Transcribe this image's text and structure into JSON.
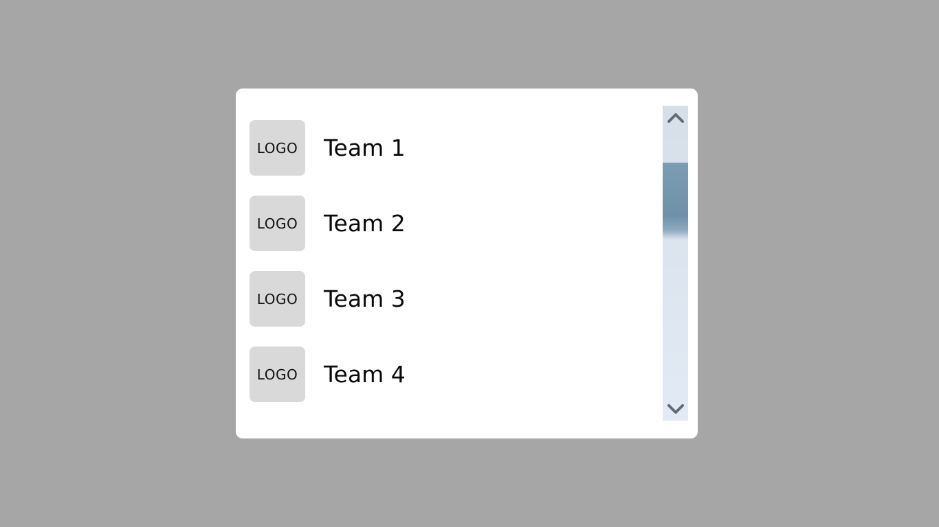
{
  "teams": [
    {
      "logo": "LOGO",
      "name": "Team 1"
    },
    {
      "logo": "LOGO",
      "name": "Team 2"
    },
    {
      "logo": "LOGO",
      "name": "Team 3"
    },
    {
      "logo": "LOGO",
      "name": "Team 4"
    }
  ],
  "scrollbar": {
    "up_icon": "chevron-up-icon",
    "down_icon": "chevron-down-icon",
    "thumb_color": "#7396ad",
    "track_color": "#dde6f0"
  },
  "colors": {
    "backdrop": "#a6a6a6",
    "panel": "#ffffff",
    "logo_placeholder": "#d9d9d9"
  }
}
